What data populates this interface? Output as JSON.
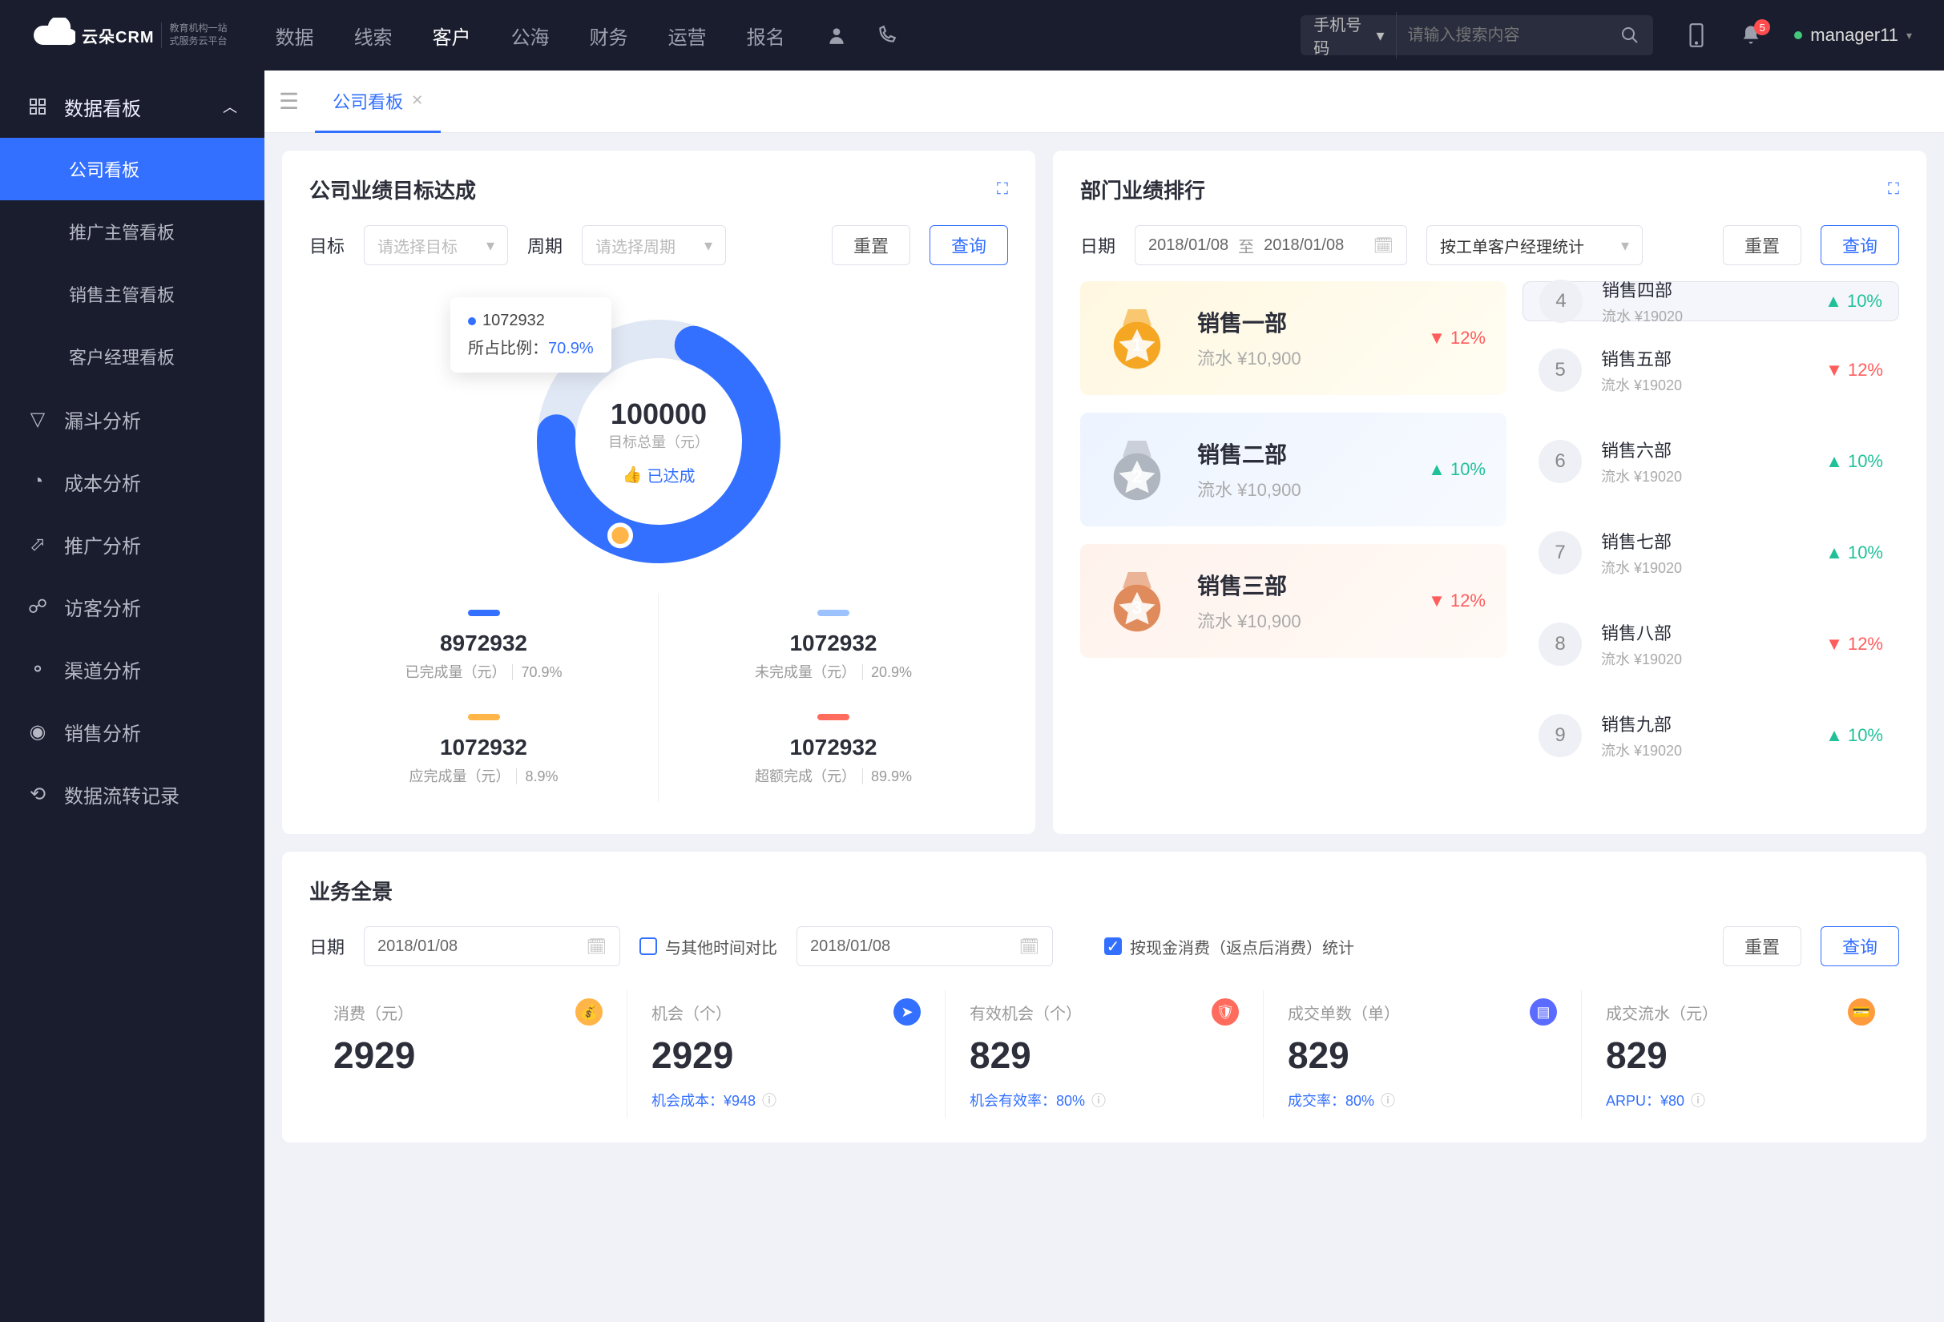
{
  "brand": {
    "name": "云朵CRM",
    "sub1": "教育机构一站",
    "sub2": "式服务云平台"
  },
  "topnav": [
    "数据",
    "线索",
    "客户",
    "公海",
    "财务",
    "运营",
    "报名"
  ],
  "topnav_active": 2,
  "search": {
    "type": "手机号码",
    "placeholder": "请输入搜索内容"
  },
  "notif_count": "5",
  "username": "manager11",
  "side_group": "数据看板",
  "side_children": [
    "公司看板",
    "推广主管看板",
    "销售主管看板",
    "客户经理看板"
  ],
  "side_active": 0,
  "side_items": [
    "漏斗分析",
    "成本分析",
    "推广分析",
    "访客分析",
    "渠道分析",
    "销售分析",
    "数据流转记录"
  ],
  "tab": {
    "label": "公司看板"
  },
  "goal": {
    "title": "公司业绩目标达成",
    "lbl_target": "目标",
    "sel_target": "请选择目标",
    "lbl_period": "周期",
    "sel_period": "请选择周期",
    "btn_reset": "重置",
    "btn_query": "查询",
    "center_val": "100000",
    "center_lbl": "目标总量（元）",
    "achieved": "已达成",
    "tooltip_val": "1072932",
    "tooltip_lbl": "所占比例：",
    "tooltip_pct": "70.9%",
    "donut_pct": 70.9,
    "stats": [
      {
        "bar": "b-blue",
        "val": "8972932",
        "lbl": "已完成量（元）",
        "pct": "70.9%"
      },
      {
        "bar": "b-lblue",
        "val": "1072932",
        "lbl": "未完成量（元）",
        "pct": "20.9%"
      },
      {
        "bar": "b-orange",
        "val": "1072932",
        "lbl": "应完成量（元）",
        "pct": "8.9%"
      },
      {
        "bar": "b-red",
        "val": "1072932",
        "lbl": "超额完成（元）",
        "pct": "89.9%"
      }
    ]
  },
  "rank": {
    "title": "部门业绩排行",
    "lbl_date": "日期",
    "date1": "2018/01/08",
    "to": "至",
    "date2": "2018/01/08",
    "sel_stat": "按工单客户经理统计",
    "btn_reset": "重置",
    "btn_query": "查询",
    "top3": [
      {
        "name": "销售一部",
        "sub": "流水 ¥10,900",
        "delta": "12%",
        "dir": "down"
      },
      {
        "name": "销售二部",
        "sub": "流水 ¥10,900",
        "delta": "10%",
        "dir": "up"
      },
      {
        "name": "销售三部",
        "sub": "流水 ¥10,900",
        "delta": "12%",
        "dir": "down"
      }
    ],
    "list": [
      {
        "n": "4",
        "name": "销售四部",
        "sub": "流水 ¥19020",
        "delta": "10%",
        "dir": "up"
      },
      {
        "n": "5",
        "name": "销售五部",
        "sub": "流水 ¥19020",
        "delta": "12%",
        "dir": "down"
      },
      {
        "n": "6",
        "name": "销售六部",
        "sub": "流水 ¥19020",
        "delta": "10%",
        "dir": "up"
      },
      {
        "n": "7",
        "name": "销售七部",
        "sub": "流水 ¥19020",
        "delta": "10%",
        "dir": "up"
      },
      {
        "n": "8",
        "name": "销售八部",
        "sub": "流水 ¥19020",
        "delta": "12%",
        "dir": "down"
      },
      {
        "n": "9",
        "name": "销售九部",
        "sub": "流水 ¥19020",
        "delta": "10%",
        "dir": "up"
      }
    ]
  },
  "overview": {
    "title": "业务全景",
    "lbl_date": "日期",
    "date1": "2018/01/08",
    "compare": "与其他时间对比",
    "date2": "2018/01/08",
    "check_lbl": "按现金消费（返点后消费）统计",
    "btn_reset": "重置",
    "btn_query": "查询",
    "kpis": [
      {
        "lbl": "消费（元）",
        "val": "2929",
        "ico": "ki-y",
        "foot": ""
      },
      {
        "lbl": "机会（个）",
        "val": "2929",
        "ico": "ki-b",
        "foot": "机会成本：¥948"
      },
      {
        "lbl": "有效机会（个）",
        "val": "829",
        "ico": "ki-r",
        "foot": "机会有效率：80%"
      },
      {
        "lbl": "成交单数（单）",
        "val": "829",
        "ico": "ki-p",
        "foot": "成交率：80%"
      },
      {
        "lbl": "成交流水（元）",
        "val": "829",
        "ico": "ki-o",
        "foot": "ARPU：¥80"
      }
    ]
  },
  "chart_data": {
    "type": "pie",
    "title": "公司业绩目标达成",
    "total": 100000,
    "total_label": "目标总量（元）",
    "series": [
      {
        "name": "已完成量（元）",
        "value": 8972932,
        "pct": 70.9,
        "color": "#3370ff"
      },
      {
        "name": "未完成量（元）",
        "value": 1072932,
        "pct": 20.9,
        "color": "#9cc3ff"
      },
      {
        "name": "应完成量（元）",
        "value": 1072932,
        "pct": 8.9,
        "color": "#ffb547"
      },
      {
        "name": "超额完成（元）",
        "value": 1072932,
        "pct": 89.9,
        "color": "#ff6b5c"
      }
    ],
    "tooltip": {
      "value": 1072932,
      "pct": 70.9
    }
  }
}
